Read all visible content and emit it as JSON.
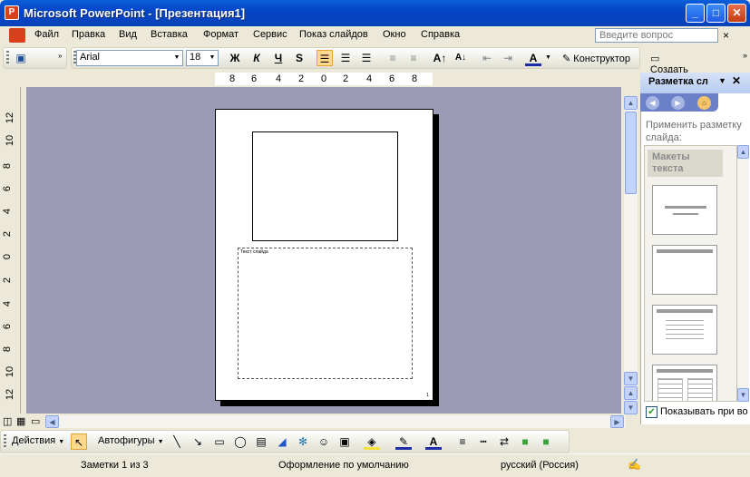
{
  "window": {
    "title": "Microsoft PowerPoint - [Презентация1]",
    "app_icon": "P"
  },
  "menu": [
    "Файл",
    "Правка",
    "Вид",
    "Вставка",
    "Формат",
    "Сервис",
    "Показ слайдов",
    "Окно",
    "Справка"
  ],
  "help": {
    "placeholder": "Введите вопрос",
    "close": "×"
  },
  "format": {
    "font": "Arial",
    "size": "18",
    "bold": "Ж",
    "italic": "К",
    "underline": "Ч",
    "shadow": "S",
    "designer": "Конструктор",
    "new_slide": "Создать слайд"
  },
  "ruler_h": [
    "8",
    "6",
    "4",
    "2",
    "0",
    "2",
    "4",
    "6",
    "8"
  ],
  "ruler_v": [
    "12",
    "10",
    "8",
    "6",
    "4",
    "2",
    "0",
    "2",
    "4",
    "6",
    "8",
    "10",
    "12"
  ],
  "slide": {
    "text_placeholder": "Текст слайда",
    "page_number": "1"
  },
  "task_pane": {
    "title": "Разметка сл",
    "apply": "Применить разметку слайда:",
    "category": "Макеты текста",
    "show_on_insert": "Показывать при во"
  },
  "draw": {
    "actions": "Действия",
    "autoshapes": "Автофигуры"
  },
  "status": {
    "slides": "Заметки 1 из 3",
    "design": "Оформление по умолчанию",
    "language": "русский (Россия)"
  },
  "icons": [
    "save-icon",
    "arrow-icon",
    "line-icon",
    "rectangle-icon",
    "oval-icon",
    "textbox-icon",
    "wordart-icon",
    "diagram-icon",
    "clipart-icon",
    "picture-icon",
    "fill-color-icon",
    "line-color-icon",
    "font-color-icon"
  ]
}
